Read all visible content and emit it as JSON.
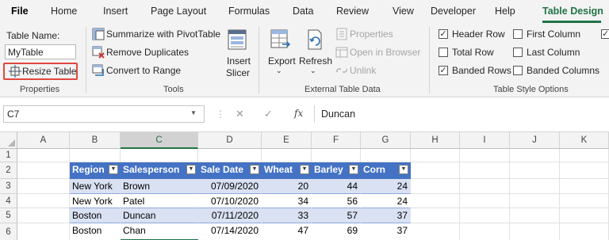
{
  "tabs": [
    {
      "label": "File",
      "bold": true
    },
    {
      "label": "Home"
    },
    {
      "label": "Insert"
    },
    {
      "label": "Page Layout"
    },
    {
      "label": "Formulas"
    },
    {
      "label": "Data"
    },
    {
      "label": "Review"
    },
    {
      "label": "View"
    },
    {
      "label": "Developer"
    },
    {
      "label": "Help"
    },
    {
      "label": "Table Design",
      "active": true
    }
  ],
  "ribbon": {
    "properties": {
      "table_name_label": "Table Name:",
      "table_name_value": "MyTable",
      "resize_label": "Resize Table",
      "group_label": "Properties"
    },
    "tools": {
      "summarize_label": "Summarize with PivotTable",
      "remove_duplicates_label": "Remove Duplicates",
      "convert_label": "Convert to Range",
      "insert_slicer_line1": "Insert",
      "insert_slicer_line2": "Slicer",
      "group_label": "Tools"
    },
    "external": {
      "export_label": "Export",
      "refresh_label": "Refresh",
      "properties_label": "Properties",
      "open_browser_label": "Open in Browser",
      "unlink_label": "Unlink",
      "group_label": "External Table Data"
    },
    "style_options": {
      "header_row": {
        "label": "Header Row",
        "checked": true
      },
      "total_row": {
        "label": "Total Row",
        "checked": false
      },
      "banded_rows": {
        "label": "Banded Rows",
        "checked": true
      },
      "first_column": {
        "label": "First Column",
        "checked": false
      },
      "last_column": {
        "label": "Last Column",
        "checked": false
      },
      "banded_columns": {
        "label": "Banded Columns",
        "checked": false
      },
      "group_label": "Table Style Options"
    }
  },
  "formula_bar": {
    "name_box": "C7",
    "fx": "fx",
    "value": "Duncan"
  },
  "grid": {
    "columns": [
      "A",
      "B",
      "C",
      "D",
      "E",
      "F",
      "G",
      "H",
      "I",
      "J",
      "K"
    ],
    "rows": [
      "1",
      "2",
      "3",
      "4",
      "5",
      "6"
    ],
    "selected_column": "C",
    "selected_row": "7"
  },
  "table": {
    "headers": [
      "Region",
      "Salesperson",
      "Sale Date",
      "Wheat",
      "Barley",
      "Corn"
    ],
    "rows": [
      [
        "New York",
        "Brown",
        "07/09/2020",
        "20",
        "44",
        "24"
      ],
      [
        "New York",
        "Patel",
        "07/10/2020",
        "34",
        "56",
        "24"
      ],
      [
        "Boston",
        "Duncan",
        "07/11/2020",
        "33",
        "57",
        "37"
      ],
      [
        "Boston",
        "Chan",
        "07/14/2020",
        "47",
        "69",
        "37"
      ]
    ],
    "header_color": "#4472c4",
    "band_color": "#d9e1f2"
  },
  "colors": {
    "accent": "#217346",
    "highlight_box": "#e0483f"
  }
}
